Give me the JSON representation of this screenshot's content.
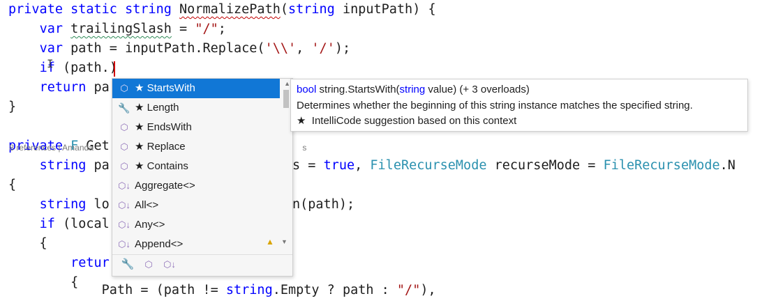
{
  "editor": {
    "lines": [
      {
        "tokens": [
          {
            "t": "private static string ",
            "c": "kw"
          },
          {
            "t": "NormalizePath",
            "c": "squig"
          },
          {
            "t": "(",
            "c": ""
          },
          {
            "t": "string",
            "c": "kw"
          },
          {
            "t": " inputPath) {",
            "c": ""
          }
        ]
      },
      {
        "tokens": [
          {
            "t": "    ",
            "c": ""
          },
          {
            "t": "var",
            "c": "kw"
          },
          {
            "t": " ",
            "c": ""
          },
          {
            "t": "trailingSlash",
            "c": "squig-g"
          },
          {
            "t": " = ",
            "c": ""
          },
          {
            "t": "\"/\"",
            "c": "str"
          },
          {
            "t": ";",
            "c": ""
          }
        ]
      },
      {
        "tokens": [
          {
            "t": "    ",
            "c": ""
          },
          {
            "t": "var",
            "c": "kw"
          },
          {
            "t": " path = inputPath.Replace(",
            "c": ""
          },
          {
            "t": "'\\\\'",
            "c": "str"
          },
          {
            "t": ", ",
            "c": ""
          },
          {
            "t": "'/'",
            "c": "str"
          },
          {
            "t": ");",
            "c": ""
          }
        ]
      },
      {
        "tokens": [
          {
            "t": "    ",
            "c": ""
          },
          {
            "t": "if",
            "c": "kw"
          },
          {
            "t": " (path.)",
            "c": ""
          }
        ]
      },
      {
        "tokens": [
          {
            "t": "    ",
            "c": ""
          },
          {
            "t": "return",
            "c": "kw"
          },
          {
            "t": " pa",
            "c": ""
          }
        ]
      },
      {
        "tokens": [
          {
            "t": "}",
            "c": ""
          }
        ]
      },
      {
        "tokens": [
          {
            "t": "private",
            "c": "kw"
          },
          {
            "t": " ",
            "c": ""
          },
          {
            "t": "F",
            "c": "ty"
          },
          {
            "t": " Get",
            "c": ""
          }
        ]
      },
      {
        "tokens": [
          {
            "t": "    ",
            "c": ""
          },
          {
            "t": "string",
            "c": "kw"
          },
          {
            "t": " pa",
            "c": ""
          }
        ]
      },
      {
        "tokens": [
          {
            "t": "{",
            "c": ""
          }
        ]
      },
      {
        "tokens": [
          {
            "t": "    ",
            "c": ""
          },
          {
            "t": "string",
            "c": "kw"
          },
          {
            "t": " lo",
            "c": ""
          }
        ]
      },
      {
        "tokens": [
          {
            "t": "    ",
            "c": ""
          },
          {
            "t": "if",
            "c": "kw"
          },
          {
            "t": " (local",
            "c": ""
          }
        ]
      },
      {
        "tokens": [
          {
            "t": "    {",
            "c": ""
          }
        ]
      },
      {
        "tokens": [
          {
            "t": "        ",
            "c": ""
          },
          {
            "t": "retur",
            "c": "kw"
          }
        ]
      },
      {
        "tokens": [
          {
            "t": "        {",
            "c": ""
          }
        ]
      },
      {
        "tokens": [
          {
            "t": "            Path = (path != ",
            "c": ""
          },
          {
            "t": "string",
            "c": "kw"
          },
          {
            "t": ".Empty ? path : ",
            "c": ""
          },
          {
            "t": "\"/\"",
            "c": "str"
          },
          {
            "t": "),",
            "c": ""
          }
        ]
      }
    ],
    "partial_right": [
      {
        "line": 7,
        "tokens": [
          {
            "t": "s = ",
            "c": ""
          },
          {
            "t": "true",
            "c": "kw"
          },
          {
            "t": ", ",
            "c": ""
          },
          {
            "t": "FileRecurseMode",
            "c": "ty"
          },
          {
            "t": " recurseMode = ",
            "c": ""
          },
          {
            "t": "FileRecurseMode",
            "c": "ty"
          },
          {
            "t": ".N",
            "c": ""
          }
        ]
      },
      {
        "line": 9,
        "tokens": [
          {
            "t": "n(path);",
            "c": ""
          }
        ]
      }
    ],
    "codelens": "8 references | Amanda",
    "codelens_tail": "s"
  },
  "completion": {
    "items": [
      {
        "icon": "method-icon",
        "glyph": "⬡",
        "label": "★ StartsWith",
        "selected": true
      },
      {
        "icon": "property-icon",
        "glyph": "🔧",
        "label": "★ Length",
        "selected": false
      },
      {
        "icon": "method-icon",
        "glyph": "⬡",
        "label": "★ EndsWith",
        "selected": false
      },
      {
        "icon": "method-icon",
        "glyph": "⬡",
        "label": "★ Replace",
        "selected": false
      },
      {
        "icon": "method-icon",
        "glyph": "⬡",
        "label": "★ Contains",
        "selected": false
      },
      {
        "icon": "extension-method-icon",
        "glyph": "⬡↓",
        "label": "Aggregate<>",
        "selected": false
      },
      {
        "icon": "extension-method-icon",
        "glyph": "⬡↓",
        "label": "All<>",
        "selected": false
      },
      {
        "icon": "extension-method-icon",
        "glyph": "⬡↓",
        "label": "Any<>",
        "selected": false
      },
      {
        "icon": "extension-method-icon",
        "glyph": "⬡↓",
        "label": "Append<>",
        "selected": false
      }
    ],
    "filters": [
      {
        "icon": "property-filter-icon",
        "glyph": "🔧"
      },
      {
        "icon": "method-filter-icon",
        "glyph": "⬡"
      },
      {
        "icon": "extension-method-filter-icon",
        "glyph": "⬡↓"
      }
    ]
  },
  "quickinfo": {
    "signature_type": "bool",
    "signature_mid": " string.StartsWith(",
    "signature_param_type": "string",
    "signature_rest": " value) (+ 3 overloads)",
    "description": "Determines whether the beginning of this string instance matches the specified string.",
    "intellicode": "★  IntelliCode suggestion based on this context"
  },
  "colors": {
    "keyword": "#0000ff",
    "type": "#2b91af",
    "string": "#a31515",
    "selection": "#1177d6"
  }
}
